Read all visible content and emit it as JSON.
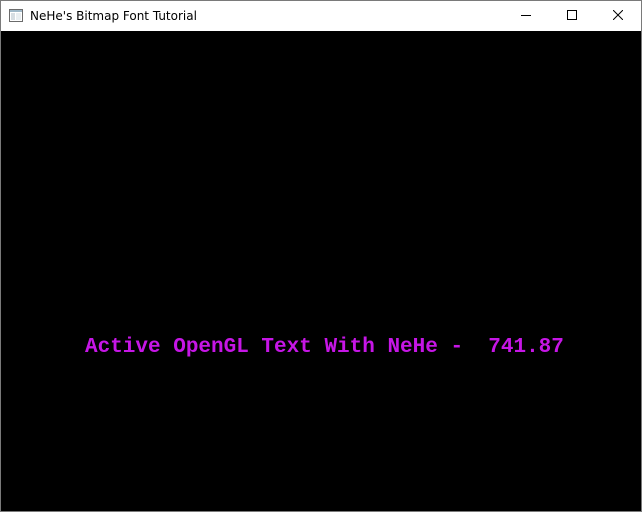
{
  "window": {
    "title": "NeHe's Bitmap Font Tutorial",
    "icon": "application-icon",
    "buttons": {
      "minimize": "minimize-icon",
      "maximize": "maximize-icon",
      "close": "close-icon"
    }
  },
  "scene": {
    "background_color": "#000000",
    "text_color": "#c616e6",
    "message": "Active OpenGL Text With NeHe -  741.87"
  }
}
